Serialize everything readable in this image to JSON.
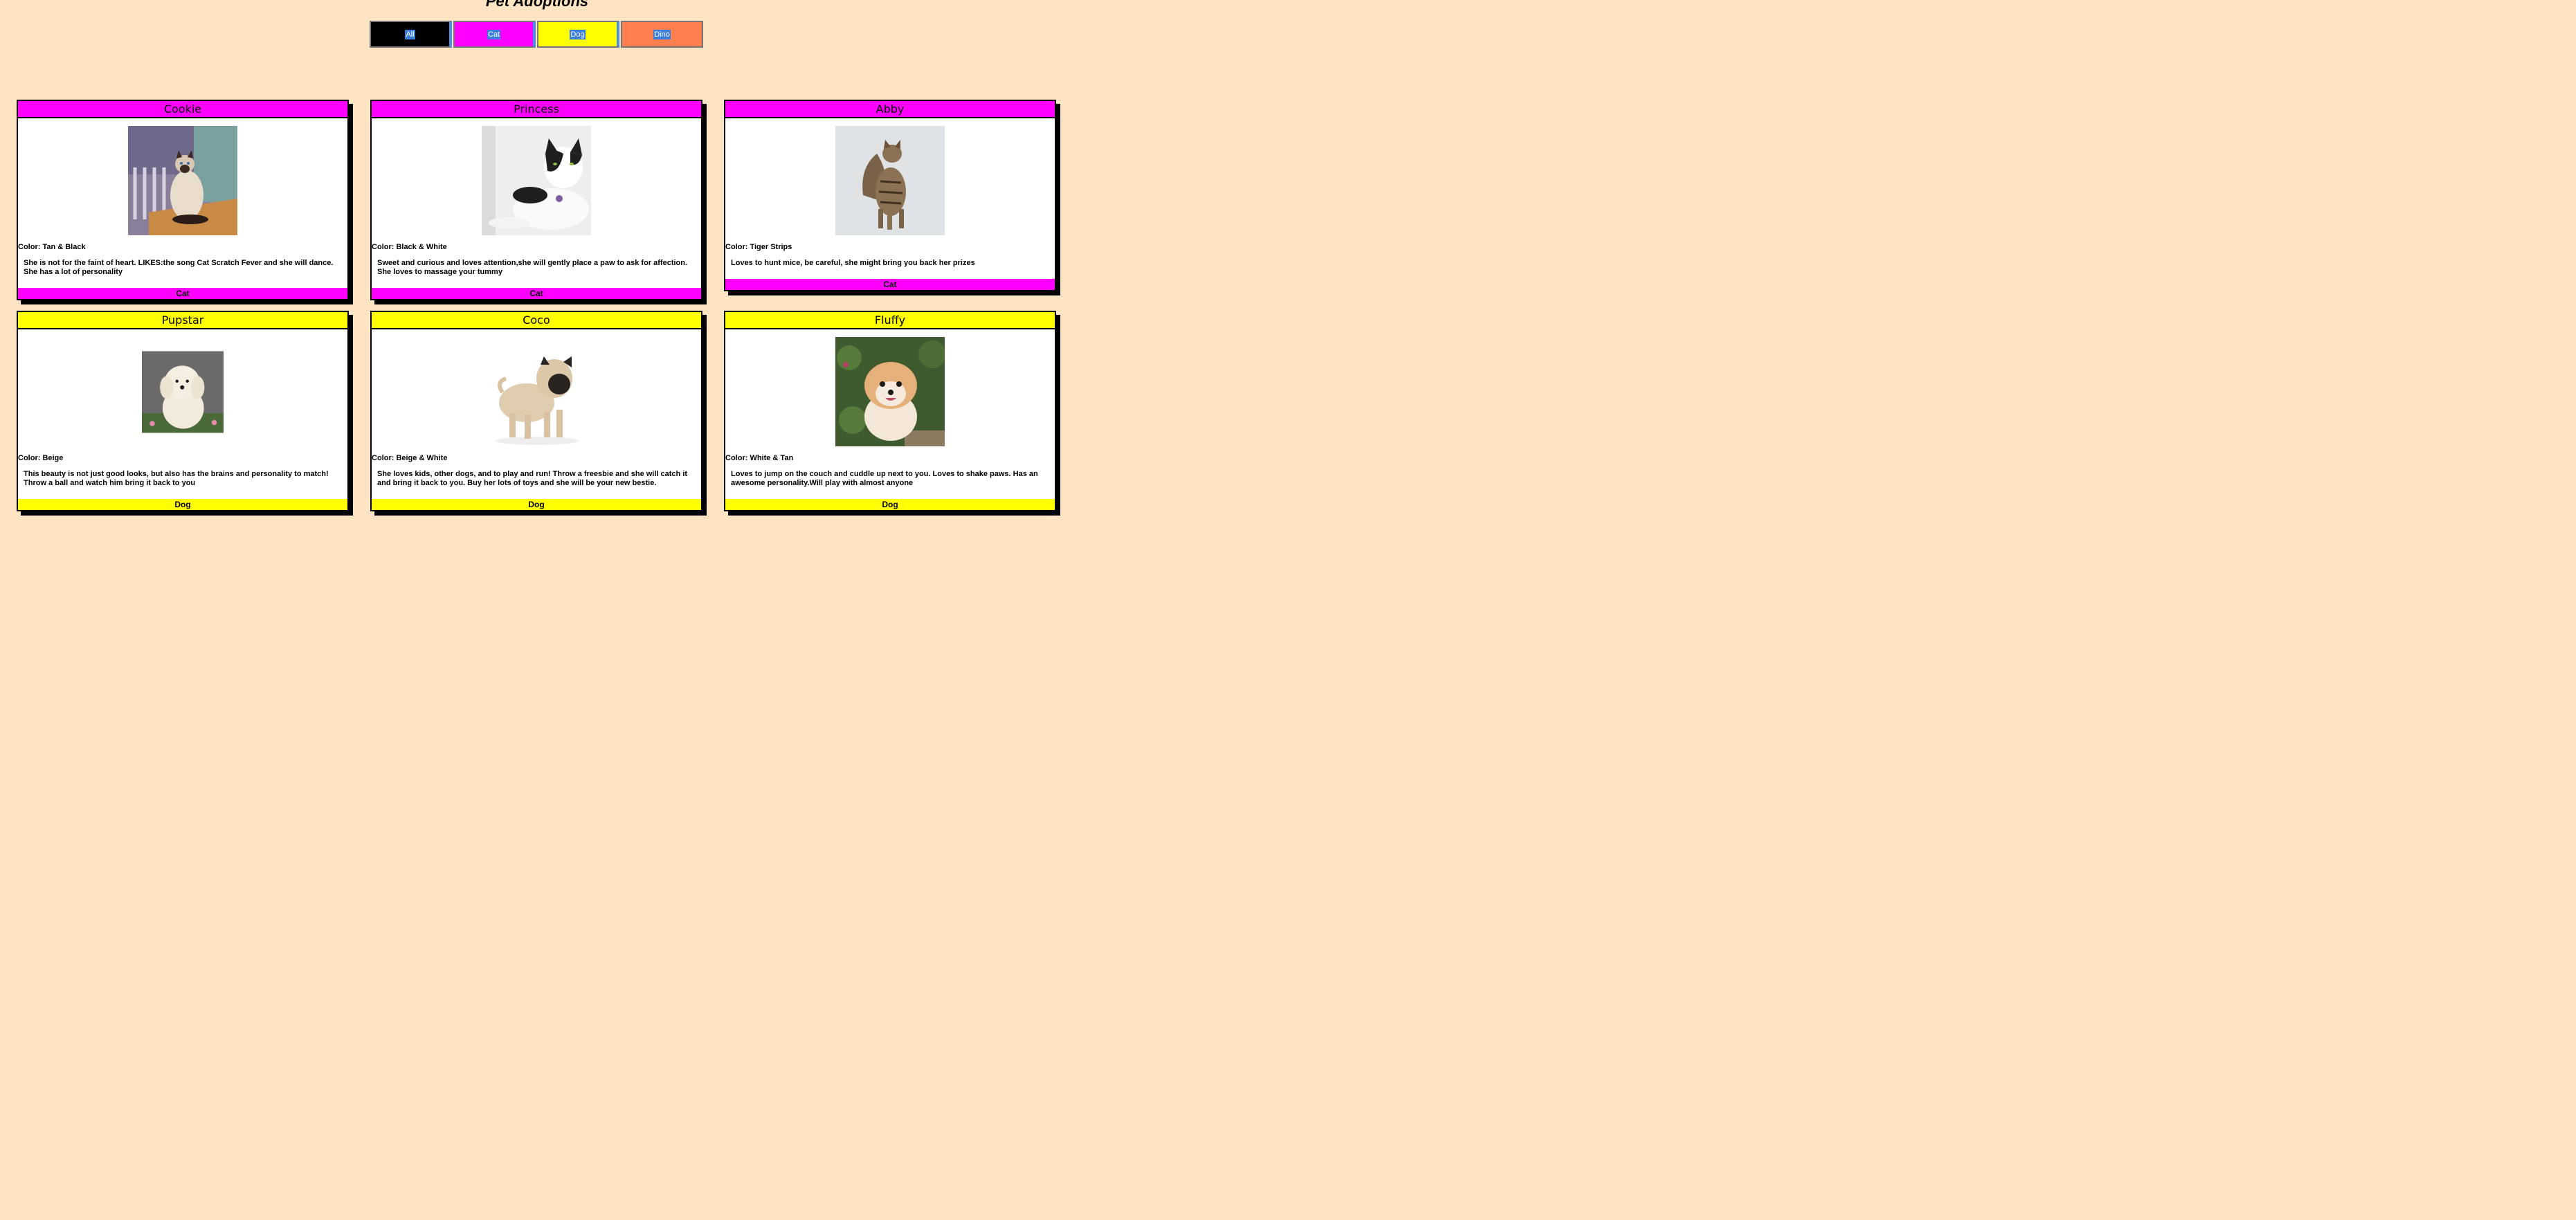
{
  "page": {
    "title": "Pet Adoptions"
  },
  "filters": [
    {
      "label": "All",
      "color": "#000000"
    },
    {
      "label": "Cat",
      "color": "#ff00ff"
    },
    {
      "label": "Dog",
      "color": "#ffff00"
    },
    {
      "label": "Dino",
      "color": "#ff7f50"
    }
  ],
  "pets": [
    {
      "name": "Cookie",
      "color": "Color: Tan & Black",
      "description": "She is not for the faint of heart. LIKES:the song Cat Scratch Fever and she will dance. She has a lot of personality",
      "type": "Cat"
    },
    {
      "name": "Princess",
      "color": "Color: Black & White",
      "description": "Sweet and curious and loves attention,she will gently place a paw to ask for affection. She loves to massage your tummy",
      "type": "Cat"
    },
    {
      "name": "Abby",
      "color": "Color: Tiger Strips",
      "description": "Loves to hunt mice, be careful, she might bring you back her prizes",
      "type": "Cat"
    },
    {
      "name": "Pupstar",
      "color": "Color: Beige",
      "description": "This beauty is not just good looks, but also has the brains and personality to match! Throw a ball and watch him bring it back to you",
      "type": "Dog"
    },
    {
      "name": "Coco",
      "color": "Color: Beige & White",
      "description": "She loves kids, other dogs, and to play and run! Throw a freesbie and she will catch it and bring it back to you. Buy her lots of toys and she will be your new bestie.",
      "type": "Dog"
    },
    {
      "name": "Fluffy",
      "color": "Color: White & Tan",
      "description": "Loves to jump on the couch and cuddle up next to you. Loves to shake paws. Has an awesome personality.Will play with almost anyone",
      "type": "Dog"
    }
  ]
}
